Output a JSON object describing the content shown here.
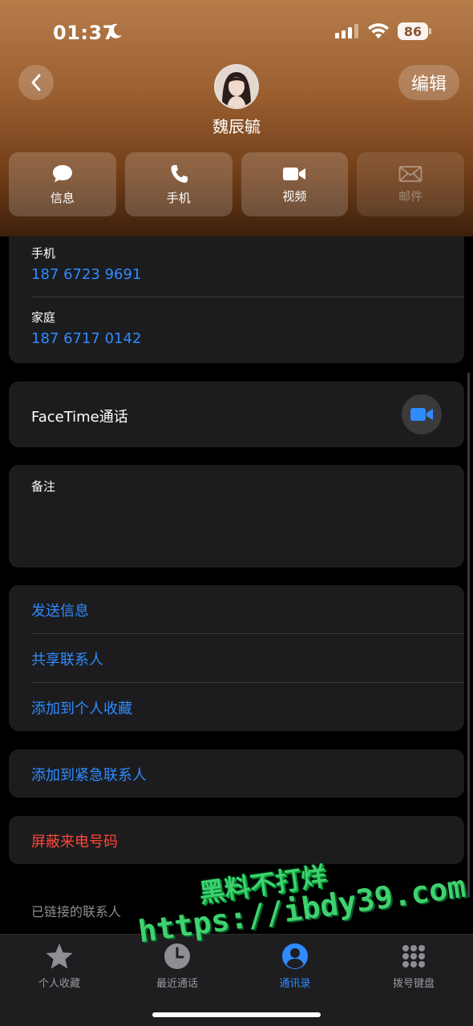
{
  "status_bar": {
    "time": "01:37",
    "battery": "86"
  },
  "header": {
    "back_icon": "chevron-left-icon",
    "edit_label": "编辑",
    "contact_name": "魏辰毓"
  },
  "actions": [
    {
      "label": "信息",
      "icon": "message-icon",
      "enabled": true
    },
    {
      "label": "手机",
      "icon": "phone-icon",
      "enabled": true
    },
    {
      "label": "视频",
      "icon": "video-icon",
      "enabled": true
    },
    {
      "label": "邮件",
      "icon": "mail-icon",
      "enabled": false
    }
  ],
  "phones": [
    {
      "label": "手机",
      "number": "187 6723 9691"
    },
    {
      "label": "家庭",
      "number": "187 6717 0142"
    }
  ],
  "facetime": {
    "label": "FaceTime通话"
  },
  "notes": {
    "label": "备注",
    "value": ""
  },
  "options": [
    {
      "label": "发送信息"
    },
    {
      "label": "共享联系人"
    },
    {
      "label": "添加到个人收藏"
    }
  ],
  "emergency": {
    "label": "添加到紧急联系人"
  },
  "block": {
    "label": "屏蔽来电号码"
  },
  "linked_contacts": {
    "label": "已链接的联系人"
  },
  "tabs": [
    {
      "label": "个人收藏",
      "icon": "star-icon",
      "active": false
    },
    {
      "label": "最近通话",
      "icon": "clock-icon",
      "active": false
    },
    {
      "label": "通讯录",
      "icon": "person-circle-icon",
      "active": true
    },
    {
      "label": "拨号键盘",
      "icon": "keypad-icon",
      "active": false
    }
  ],
  "watermark": {
    "line1": "黑料不打烊",
    "line2": "https://ibdy39.com"
  },
  "colors": {
    "accent": "#2f8bff",
    "destructive": "#ff453a",
    "card": "#1c1c1e",
    "watermark": "#3fd26e"
  }
}
